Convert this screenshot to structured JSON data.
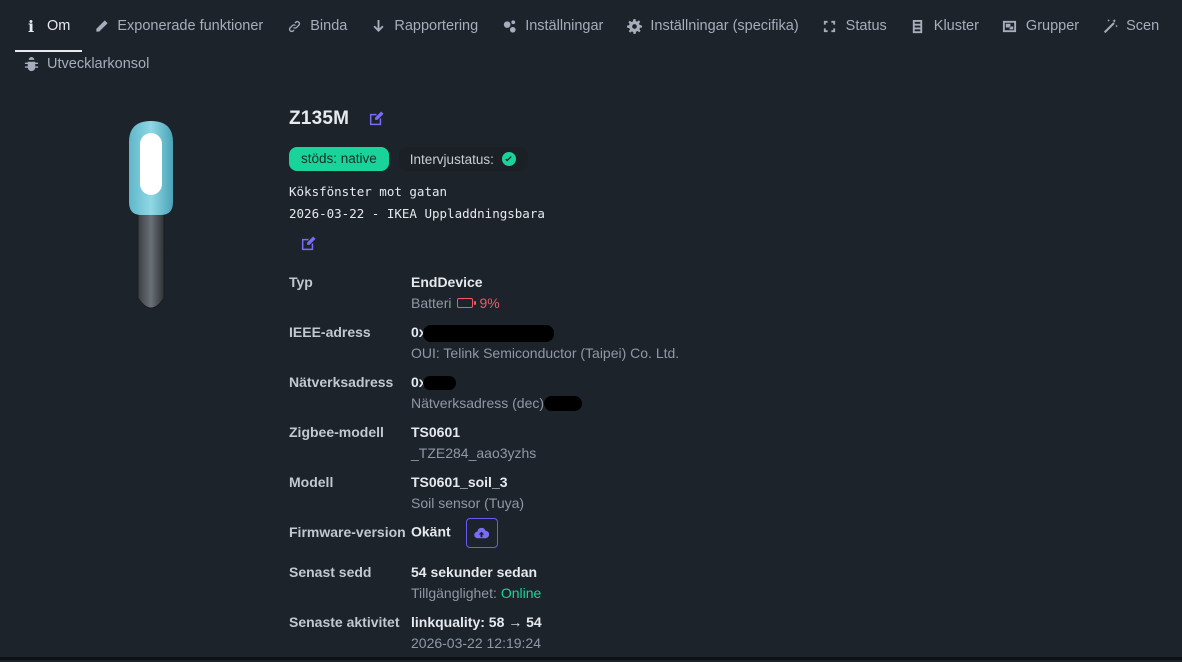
{
  "tabs": [
    {
      "label": "Om",
      "icon": "info-icon",
      "active": true
    },
    {
      "label": "Exponerade funktioner",
      "icon": "pencil-icon"
    },
    {
      "label": "Binda",
      "icon": "link-icon"
    },
    {
      "label": "Rapportering",
      "icon": "arrow-down-icon"
    },
    {
      "label": "Inställningar",
      "icon": "cogs-icon"
    },
    {
      "label": "Inställningar (specifika)",
      "icon": "gear-icon"
    },
    {
      "label": "Status",
      "icon": "refresh-icon"
    },
    {
      "label": "Kluster",
      "icon": "server-icon"
    },
    {
      "label": "Grupper",
      "icon": "object-group-icon"
    },
    {
      "label": "Scen",
      "icon": "magic-wand-icon"
    },
    {
      "label": "Utvecklarkonsol",
      "icon": "bug-icon"
    }
  ],
  "device": {
    "name": "Z135M",
    "support_badge": "stöds: native",
    "interview_label": "Intervjustatus:",
    "description_lines": [
      "Köksfönster mot gatan",
      "2026-03-22 - IKEA Uppladdningsbara"
    ]
  },
  "info": {
    "type": {
      "label": "Typ",
      "value": "EndDevice",
      "sub_label": "Batteri",
      "battery": "9%"
    },
    "ieee": {
      "label": "IEEE-adress",
      "value": "0x",
      "sub": "OUI: Telink Semiconductor (Taipei) Co. Ltd."
    },
    "network": {
      "label": "Nätverksadress",
      "value": "0x",
      "sub": "Nätverksadress (dec):"
    },
    "zigbee_model": {
      "label": "Zigbee-modell",
      "value": "TS0601",
      "sub": "_TZE284_aao3yzhs"
    },
    "model": {
      "label": "Modell",
      "value": "TS0601_soil_3",
      "sub": "Soil sensor (Tuya)"
    },
    "firmware": {
      "label": "Firmware-version",
      "value": "Okänt"
    },
    "last_seen": {
      "label": "Senast sedd",
      "value": "54 sekunder sedan",
      "sub_label": "Tillgänglighet:",
      "sub_value": "Online"
    },
    "last_activity": {
      "label": "Senaste aktivitet",
      "value": "linkquality: 58 → 54",
      "sub": "2026-03-22 12:19:24"
    }
  },
  "colors": {
    "accent": "#7b6cf6",
    "success": "#19d49a",
    "danger": "#f2576b",
    "background": "#1d232a"
  }
}
